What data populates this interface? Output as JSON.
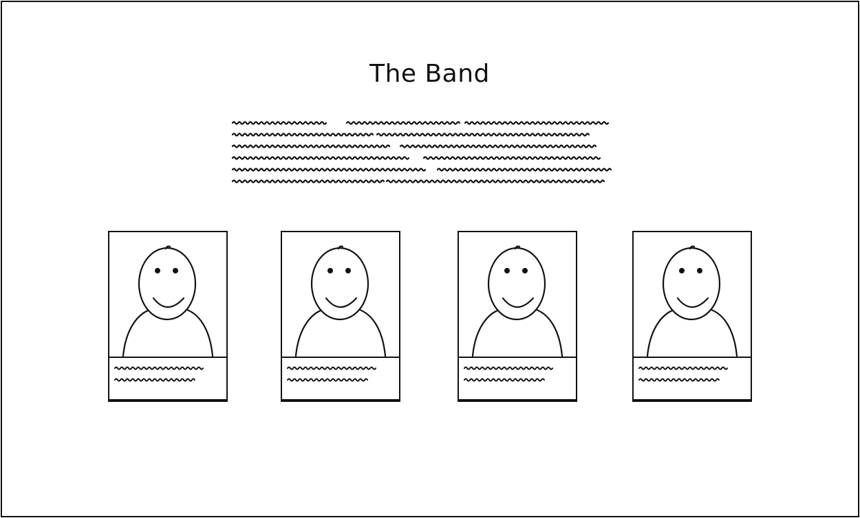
{
  "page": {
    "title": "The Band"
  },
  "members": [
    {
      "avatar_icon": "person-icon"
    },
    {
      "avatar_icon": "person-icon"
    },
    {
      "avatar_icon": "person-icon"
    },
    {
      "avatar_icon": "person-icon"
    }
  ],
  "colors": {
    "ink": "#111111",
    "background": "#ffffff"
  }
}
